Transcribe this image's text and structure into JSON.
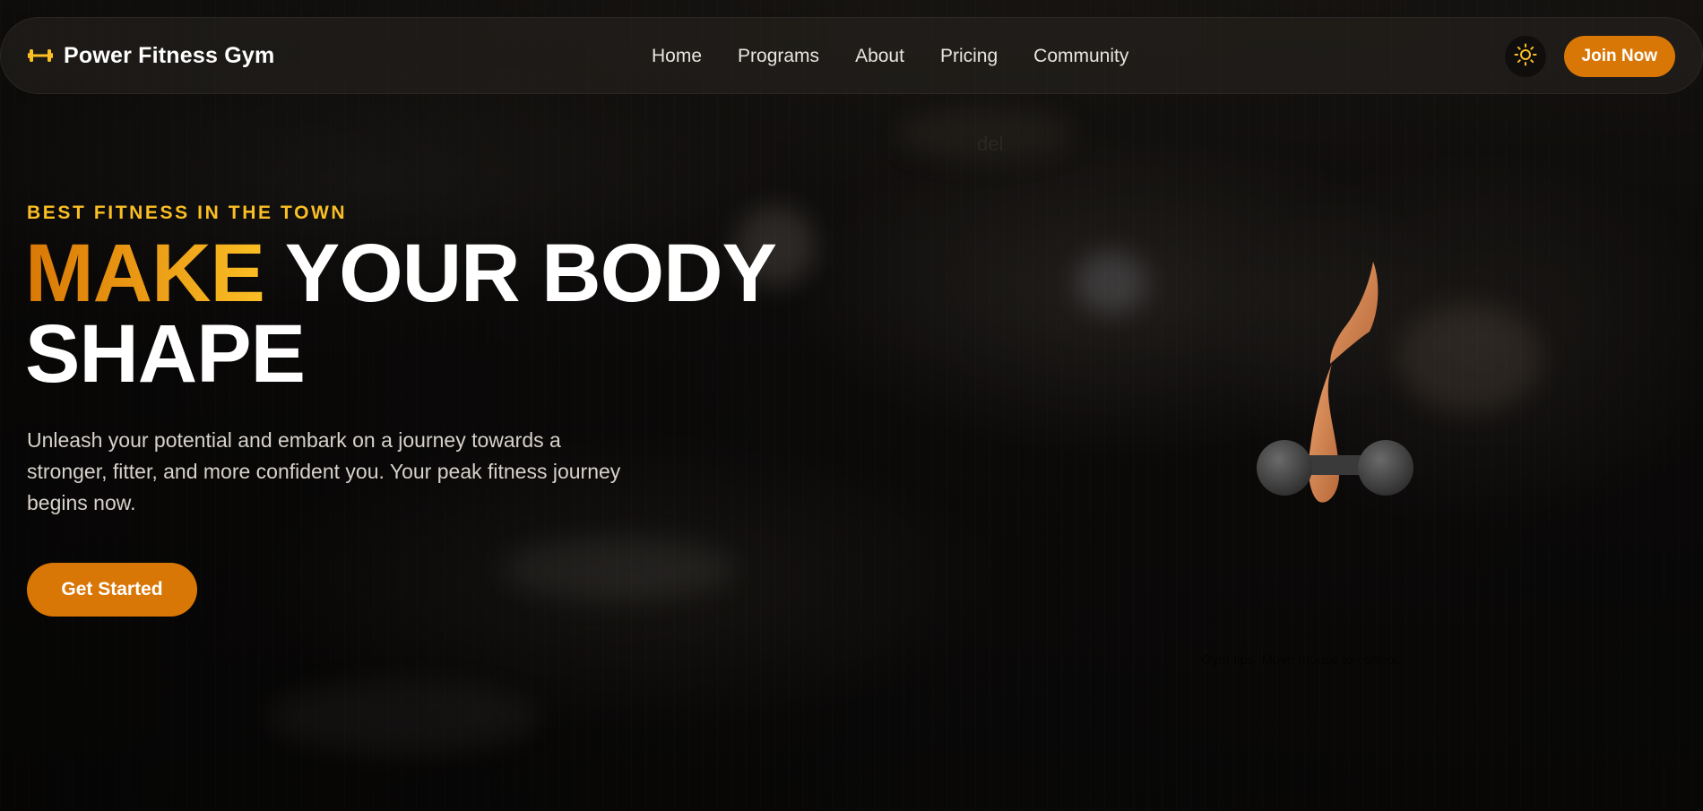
{
  "brand": {
    "name": "Power Fitness Gym",
    "icon": "dumbbell-icon",
    "color": "#fbbf24"
  },
  "nav": {
    "links": [
      "Home",
      "Programs",
      "About",
      "Pricing",
      "Community"
    ],
    "theme_toggle_icon": "sun-icon",
    "join_label": "Join Now"
  },
  "hero": {
    "eyebrow": "BEST FITNESS IN THE TOWN",
    "headline_accent": "MAKE",
    "headline_rest": "YOUR BODY SHAPE",
    "subtext": "Unleash your potential and embark on a journey towards a stronger, fitter, and more confident you. Your peak fitness journey begins now.",
    "cta_label": "Get Started"
  },
  "scene": {
    "label": "del",
    "hint": "Gym tips. Move mouse to control."
  },
  "colors": {
    "accent": "#d97706",
    "accent_light": "#fbbf24",
    "text": "#ffffff"
  }
}
